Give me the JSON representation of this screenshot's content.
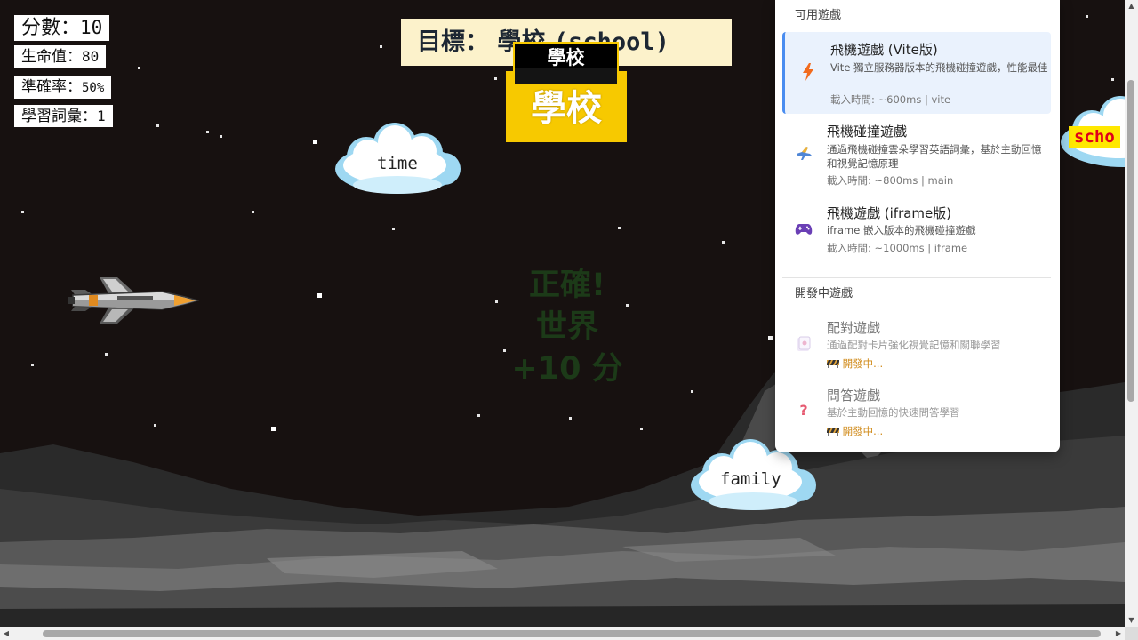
{
  "hud": {
    "score_label": "分數：",
    "score_value": "10",
    "hp_label": "生命值：",
    "hp_value": "80",
    "accuracy_label": "準確率：",
    "accuracy_value": "50%",
    "vocab_label": "學習詞彙：",
    "vocab_value": "1"
  },
  "target": {
    "label": "目標：",
    "word_zh": "學校",
    "word_en": "(school)"
  },
  "card": {
    "tag": "學校",
    "big": "學校"
  },
  "feedback": {
    "line1": "正確!",
    "line2": "世界",
    "line3": "+10 分"
  },
  "clouds": {
    "time": "time",
    "family": "family",
    "scho": "scho"
  },
  "menu": {
    "section_available": "可用遊戲",
    "section_dev": "開發中遊戲",
    "items": [
      {
        "icon": "lightning-icon",
        "title": "飛機遊戲 (Vite版)",
        "desc": "Vite 獨立服務器版本的飛機碰撞遊戲，性能最佳",
        "meta": "載入時間: ~600ms | vite"
      },
      {
        "icon": "airplane-icon",
        "title": "飛機碰撞遊戲",
        "desc": "通過飛機碰撞雲朵學習英語詞彙，基於主動回憶和視覺記憶原理",
        "meta": "載入時間: ~800ms | main"
      },
      {
        "icon": "gamepad-icon",
        "title": "飛機遊戲 (iframe版)",
        "desc": "iframe 嵌入版本的飛機碰撞遊戲",
        "meta": "載入時間: ~1000ms | iframe"
      },
      {
        "icon": "cards-icon",
        "title": "配對遊戲",
        "desc": "通過配對卡片強化視覺記憶和關聯學習",
        "meta": "開發中..."
      },
      {
        "icon": "question-icon",
        "title": "問答遊戲",
        "desc": "基於主動回憶的快速問答學習",
        "meta": "開發中..."
      }
    ]
  },
  "colors": {
    "sky": "#171110",
    "card_yellow": "#f7c900",
    "target_bg": "#fcf2cb",
    "menu_active": "#eaf2fd",
    "accent": "#4a8df0",
    "dev_orange": "#d08a18"
  }
}
